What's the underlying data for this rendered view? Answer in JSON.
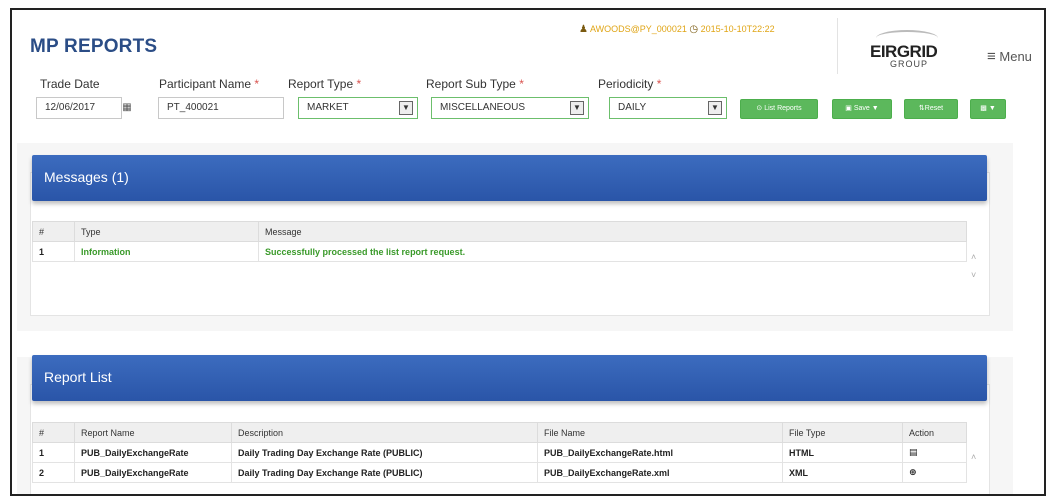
{
  "app": {
    "title": "MP REPORTS"
  },
  "user": {
    "name": "AWOODS@PY_000021",
    "timestamp": "2015-10-10T22:22"
  },
  "logo": {
    "brand": "EIRGRID",
    "sub": "GROUP"
  },
  "menu": {
    "label": "Menu",
    "icon": "hamburger-icon"
  },
  "filters": {
    "trade_date": {
      "label": "Trade Date",
      "value": "12/06/2017"
    },
    "participant": {
      "label": "Participant Name",
      "value": "PT_400021"
    },
    "report_type": {
      "label": "Report Type",
      "value": "MARKET"
    },
    "report_sub_type": {
      "label": "Report Sub Type",
      "value": "MISCELLANEOUS"
    },
    "periodicity": {
      "label": "Periodicity",
      "value": "DAILY"
    },
    "required_mark": "*"
  },
  "toolbar": {
    "list_reports": "List Reports",
    "save": "Save",
    "reset": "Reset"
  },
  "messages": {
    "title": "Messages (1)",
    "columns": [
      "#",
      "Type",
      "Message"
    ],
    "rows": [
      {
        "num": "1",
        "type": "Information",
        "message": "Successfully processed the list report request."
      }
    ]
  },
  "reports": {
    "title": "Report List",
    "columns": [
      "#",
      "Report Name",
      "Description",
      "File Name",
      "File Type",
      "Action"
    ],
    "rows": [
      {
        "num": "1",
        "name": "PUB_DailyExchangeRate",
        "description": "Daily Trading Day Exchange Rate (PUBLIC)",
        "file": "PUB_DailyExchangeRate.html",
        "type": "HTML",
        "action_icon": "view-icon"
      },
      {
        "num": "2",
        "name": "PUB_DailyExchangeRate",
        "description": "Daily Trading Day Exchange Rate (PUBLIC)",
        "file": "PUB_DailyExchangeRate.xml",
        "type": "XML",
        "action_icon": "download-icon"
      }
    ]
  },
  "colors": {
    "title": "#2b4d86",
    "accent_green": "#5cb85c",
    "panel_blue": "#2f5cae",
    "user_text": "#e0a516"
  }
}
